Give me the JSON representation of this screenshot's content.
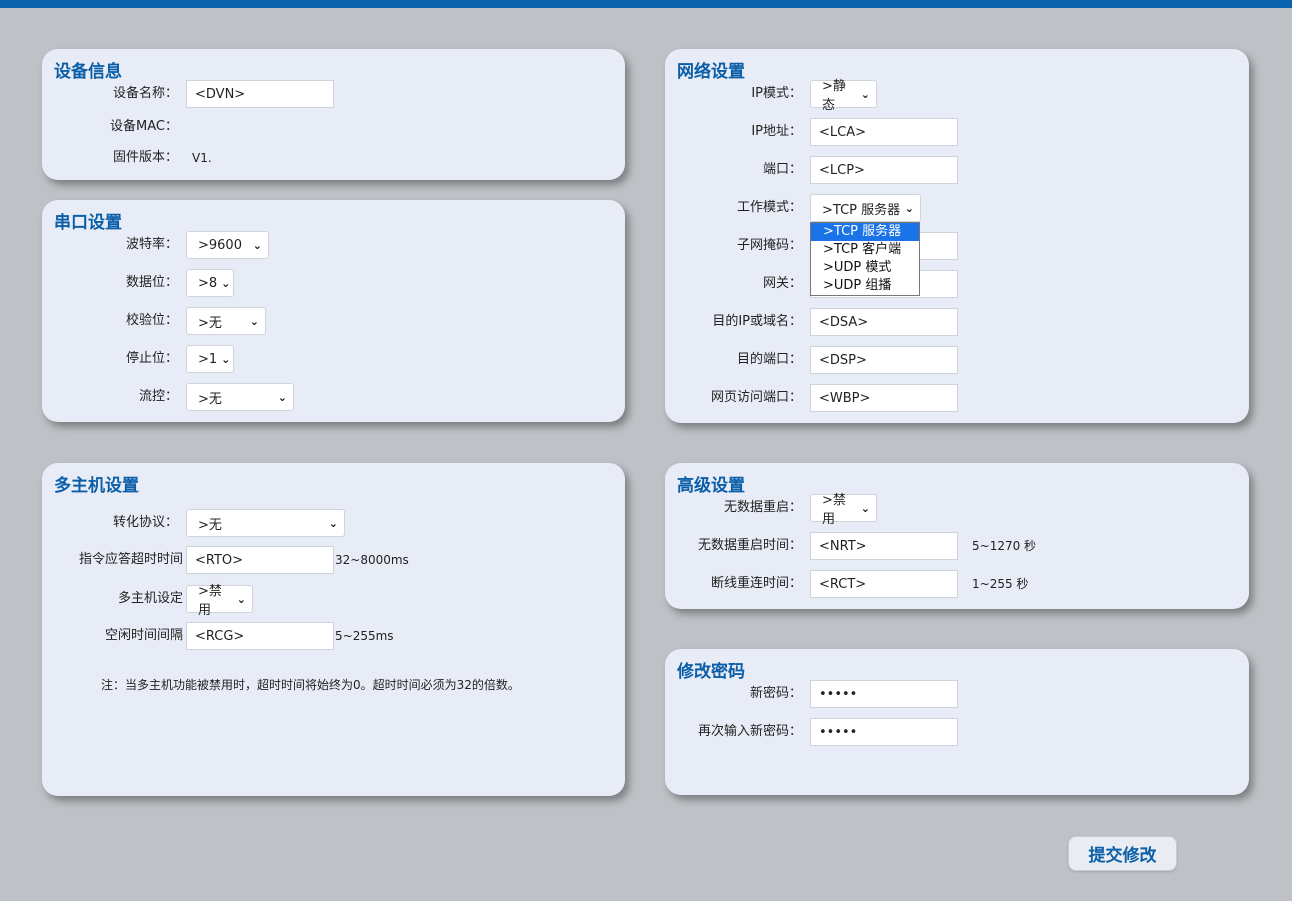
{
  "device_info": {
    "title": "设备信息",
    "name_label": "设备名称：",
    "name_value": "<DVN>",
    "mac_label": "设备MAC：",
    "mac_value": "",
    "firmware_label": "固件版本：",
    "firmware_value": "V1."
  },
  "serial": {
    "title": "串口设置",
    "baud_label": "波特率：",
    "baud_value": ">9600",
    "databits_label": "数据位：",
    "databits_value": ">8",
    "parity_label": "校验位：",
    "parity_value": ">无",
    "stopbits_label": "停止位：",
    "stopbits_value": ">1",
    "flow_label": "流控：",
    "flow_value": ">无"
  },
  "multihost": {
    "title": "多主机设置",
    "protocol_label": "转化协议：",
    "protocol_value": ">无",
    "timeout_label": "指令应答超时时间",
    "timeout_value": "<RTO>",
    "timeout_range": "32~8000ms",
    "mode_label": "多主机设定",
    "mode_value": ">禁用",
    "idle_label": "空闲时间间隔",
    "idle_value": "<RCG>",
    "idle_range": "5~255ms",
    "note": "注：当多主机功能被禁用时，超时时间将始终为0。超时时间必须为32的倍数。"
  },
  "network": {
    "title": "网络设置",
    "ipmode_label": "IP模式：",
    "ipmode_value": ">静态",
    "ip_label": "IP地址：",
    "ip_value": "<LCA>",
    "port_label": "端口：",
    "port_value": "<LCP>",
    "workmode_label": "工作模式：",
    "workmode_value": ">TCP 服务器",
    "workmode_options": [
      ">TCP 服务器",
      ">TCP 客户端",
      ">UDP 模式",
      ">UDP 组播"
    ],
    "subnet_label": "子网掩码：",
    "gateway_label": "网关：",
    "dest_ip_label": "目的IP或域名：",
    "dest_ip_value": "<DSA>",
    "dest_port_label": "目的端口：",
    "dest_port_value": "<DSP>",
    "web_port_label": "网页访问端口：",
    "web_port_value": "<WBP>"
  },
  "advanced": {
    "title": "高级设置",
    "nodata_reboot_label": "无数据重启：",
    "nodata_reboot_value": ">禁用",
    "nodata_time_label": "无数据重启时间：",
    "nodata_time_value": "<NRT>",
    "nodata_time_range": "5~1270 秒",
    "reconnect_label": "断线重连时间：",
    "reconnect_value": "<RCT>",
    "reconnect_range": "1~255 秒"
  },
  "password": {
    "title": "修改密码",
    "new_label": "新密码：",
    "new_value": "•••••",
    "confirm_label": "再次输入新密码：",
    "confirm_value": "•••••"
  },
  "submit_label": "提交修改"
}
